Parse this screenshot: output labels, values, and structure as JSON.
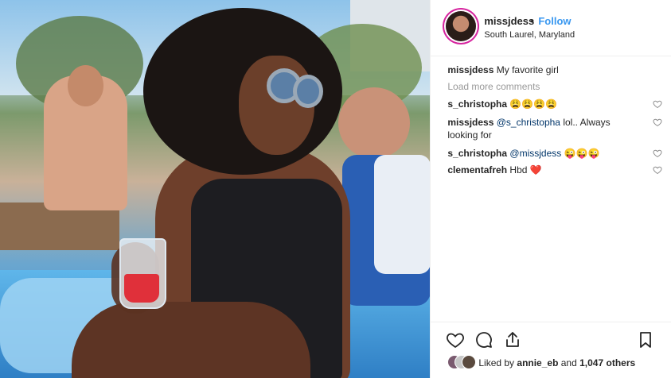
{
  "post": {
    "photo_alt": "",
    "header": {
      "username": "missjdess",
      "dot": "•",
      "follow_label": "Follow",
      "location": "South Laurel, Maryland"
    },
    "caption": {
      "username": "missjdess",
      "text": "My favorite girl"
    },
    "load_more_label": "Load more comments",
    "comments": [
      {
        "username": "s_christopha",
        "mention": "",
        "text": "😩😩😩😩"
      },
      {
        "username": "missjdess",
        "mention": "@s_christopha",
        "text": " lol.. Always looking for"
      },
      {
        "username": "s_christopha",
        "mention": "@missjdess",
        "text": " 😜😜😜"
      },
      {
        "username": "clementafreh",
        "mention": "",
        "text": "Hbd ❤️"
      }
    ],
    "likes": {
      "prefix": "Liked by ",
      "user": "annie_eb",
      "middle": " and ",
      "others": "1,047 others"
    },
    "icons": {
      "heart_comment": "heart-outline-icon",
      "like": "heart-icon",
      "comment": "comment-icon",
      "share": "share-icon",
      "save": "bookmark-icon"
    },
    "colors": {
      "follow": "#3897f0",
      "mention": "#003569",
      "muted": "#999999",
      "border": "#efefef"
    }
  }
}
